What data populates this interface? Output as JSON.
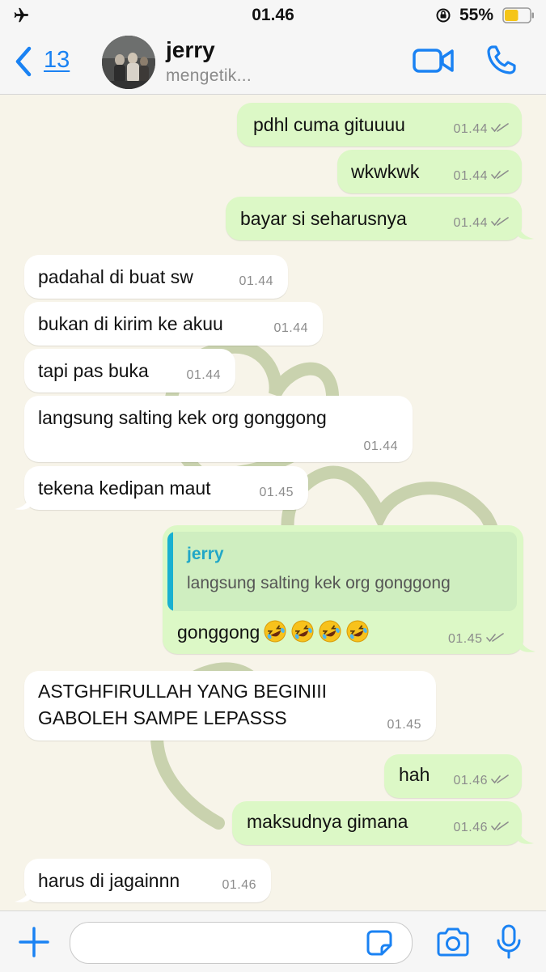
{
  "status_bar": {
    "time": "01.46",
    "battery_percent": "55%",
    "battery_level": 0.55,
    "airplane_icon": "airplane-icon",
    "rotation_lock_icon": "rotation-lock-icon"
  },
  "header": {
    "back_count": "13",
    "contact_name": "jerry",
    "contact_status": "mengetik...",
    "icons": [
      "back-chevron-icon",
      "video-call-icon",
      "phone-call-icon"
    ],
    "accent_color": "#1a82f3"
  },
  "messages": [
    {
      "dir": "out",
      "text": "pdhl cuma gituuuu",
      "time": "01.44"
    },
    {
      "dir": "out",
      "text": "wkwkwk",
      "time": "01.44"
    },
    {
      "dir": "out",
      "text": "bayar si seharusnya",
      "time": "01.44"
    },
    {
      "dir": "in",
      "text": "padahal di buat sw",
      "time": "01.44"
    },
    {
      "dir": "in",
      "text": "bukan di kirim ke akuu",
      "time": "01.44"
    },
    {
      "dir": "in",
      "text": "tapi pas buka",
      "time": "01.44"
    },
    {
      "dir": "in",
      "text": "langsung salting kek org gonggong",
      "time": "01.44"
    },
    {
      "dir": "in",
      "text": "tekena kedipan maut",
      "time": "01.45"
    },
    {
      "dir": "out",
      "reply_to": {
        "name": "jerry",
        "text": "langsung salting kek org gonggong"
      },
      "text": "gonggong",
      "emoji": "rolling-on-floor-laughing x4",
      "time": "01.45"
    },
    {
      "dir": "in",
      "lines": [
        "ASTGHFIRULLAH YANG BEGINIII",
        "GABOLEH SAMPE LEPASSS"
      ],
      "time": "01.45"
    },
    {
      "dir": "out",
      "text": "hah",
      "time": "01.46"
    },
    {
      "dir": "out",
      "text": "maksudnya gimana",
      "time": "01.46"
    },
    {
      "dir": "in",
      "text": "harus di jagainnn",
      "time": "01.46"
    }
  ],
  "colors": {
    "outgoing_bubble": "#dcf8c6",
    "incoming_bubble": "#ffffff",
    "wallpaper": "#f7f4e9",
    "reply_accent": "#19b0d0"
  },
  "input_bar": {
    "placeholder": "",
    "icons": [
      "plus-icon",
      "sticker-icon",
      "camera-icon",
      "microphone-icon"
    ]
  }
}
